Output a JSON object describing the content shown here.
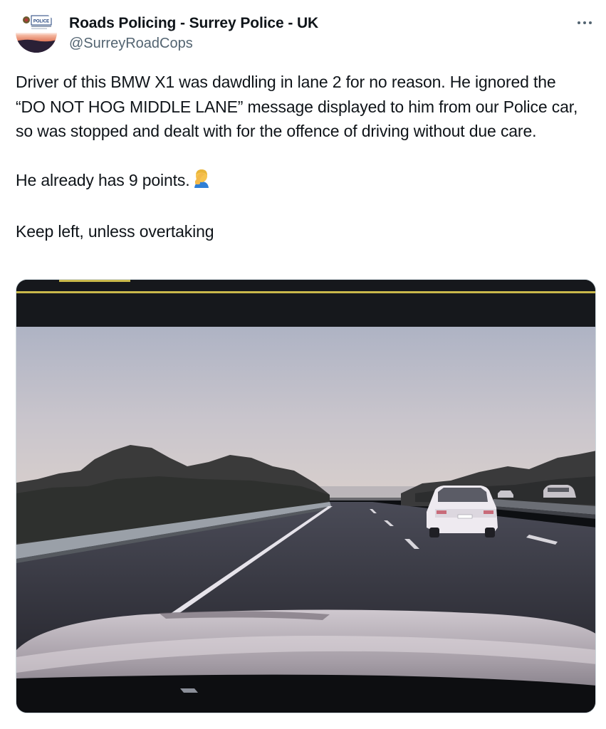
{
  "tweet": {
    "author": {
      "display_name": "Roads Policing - Surrey Police - UK",
      "handle": "@SurreyRoadCops",
      "avatar_label": "POLICE"
    },
    "more_icon": "more-horizontal-icon",
    "paragraphs": [
      "Driver of this BMW X1 was dawdling in lane 2 for no reason. He ignored the “DO NOT HOG MIDDLE LANE” message displayed to him from our Police car, so was stopped and dealt with for the offence of driving without due care.",
      "He already has 9 points.",
      "Keep left, unless overtaking"
    ],
    "emoji": "facepalm-emoji",
    "media": {
      "type": "dashcam-photo"
    }
  },
  "colors": {
    "text": "#0f1419",
    "secondary": "#536471",
    "border": "#cfd9de"
  }
}
